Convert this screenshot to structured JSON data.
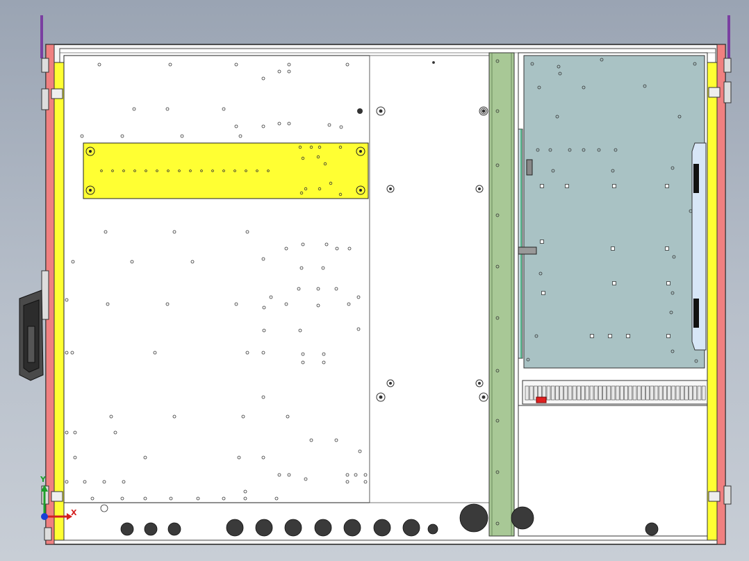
{
  "viewport": {
    "background_top": "#9aa4b3",
    "background_bottom": "#c8ced6"
  },
  "axes": {
    "x_label": "X",
    "y_label": "Y",
    "x_color": "#d41f1f",
    "y_color": "#1e9f2b",
    "z_color": "#1a3fd6"
  },
  "colors": {
    "side_rail_yellow": "#ffff33",
    "side_rail_red": "#f08080",
    "mounting_plate_yellow": "#ffff33",
    "green_channel": "#a8c896",
    "pcb_board": "#a9c2c4",
    "terminal_marker": "#e02020",
    "handle": "#3a3a3a",
    "panel": "#ffffff"
  },
  "assembly": {
    "handle_icon": "door-handle-icon",
    "terminal_strip_icon": "terminal-block-icon"
  }
}
